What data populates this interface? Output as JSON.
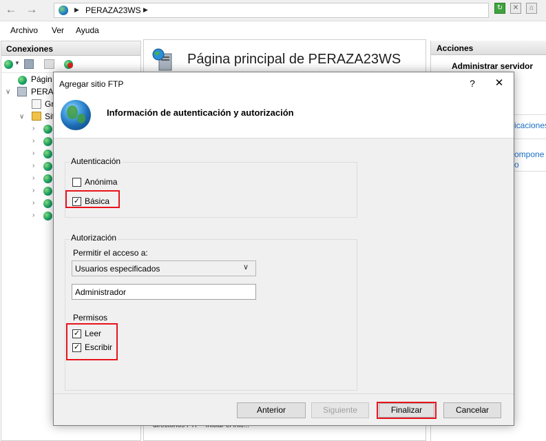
{
  "address_bar": {
    "path": "PERAZA23WS"
  },
  "menu": [
    "Archivo",
    "Ver",
    "Ayuda"
  ],
  "connections": {
    "title": "Conexiones",
    "tree": [
      {
        "label": "Págin"
      },
      {
        "label": "PERAZ"
      },
      {
        "label": "Gr"
      },
      {
        "label": "Sit"
      }
    ]
  },
  "center": {
    "title": "Página principal de PERAZA23WS",
    "bottom_text": "directorios FTP · Iniciar el inic..."
  },
  "actions": {
    "title": "Acciones",
    "subtitle": "Administrar servidor",
    "links": [
      "icaciones",
      "ompone",
      "o"
    ]
  },
  "dialog": {
    "title": "Agregar sitio FTP",
    "help": "?",
    "close": "✕",
    "heading": "Información de autenticación y autorización",
    "auth": {
      "label": "Autenticación",
      "anonymous": {
        "label": "Anónima",
        "checked": false
      },
      "basic": {
        "label": "Básica",
        "checked": true
      }
    },
    "authorization": {
      "label": "Autorización",
      "access_label": "Permitir el acceso a:",
      "access_selected": "Usuarios especificados",
      "user_value": "Administrador",
      "permissions_label": "Permisos",
      "read": {
        "label": "Leer",
        "checked": true
      },
      "write": {
        "label": "Escribir",
        "checked": true
      }
    },
    "buttons": {
      "previous": "Anterior",
      "next": "Siguiente",
      "finish": "Finalizar",
      "cancel": "Cancelar"
    }
  },
  "colors": {
    "highlight_red": "#e8121b",
    "panel_bg": "#f0f0f0",
    "link_blue": "#1a6fc4"
  }
}
